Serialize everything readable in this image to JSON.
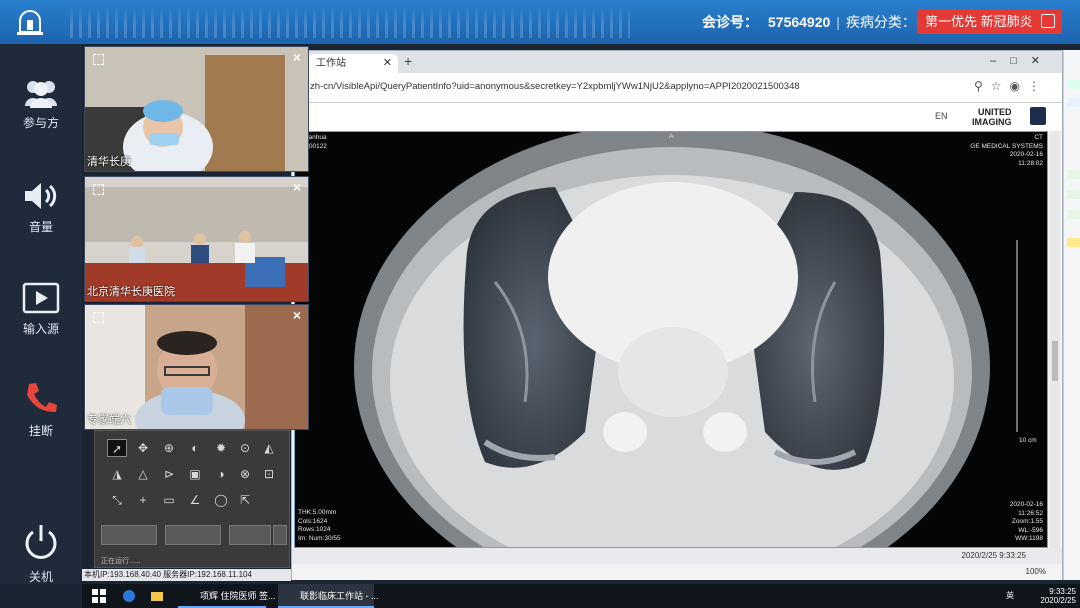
{
  "header": {
    "meeting_label": "会诊号：",
    "meeting_number": "57564920",
    "separator": "|",
    "category_label": "疾病分类：",
    "priority_text": "第一优先 新冠肺炎",
    "logo_icon": "siren-icon",
    "edit_icon": "edit-icon"
  },
  "sidebar": {
    "items": [
      {
        "label": "参与方",
        "icon": "participants-icon"
      },
      {
        "label": "音量",
        "icon": "speaker-icon"
      },
      {
        "label": "输入源",
        "icon": "play-icon"
      },
      {
        "label": "挂断",
        "icon": "hangup-icon"
      },
      {
        "label": "关机",
        "icon": "power-icon"
      }
    ]
  },
  "videos": [
    {
      "caption": "清华长庚"
    },
    {
      "caption": "北京清华长庚医院"
    },
    {
      "caption": "专家端六"
    }
  ],
  "browser": {
    "tab_title": "工作站",
    "url": "zh-cn/VisibleApi/QueryPatientInfo?uid=anonymous&secretkey=Y2xpbmljYWw1NjU2&applyno=APPI2020021500348",
    "lang": "EN",
    "brand_line1": "UNITED",
    "brand_line2": "IMAGING",
    "viewer": {
      "top_left": [
        "ngyanhua",
        "20200122"
      ],
      "top_center": "A",
      "top_right": [
        "CT",
        "GE MEDICAL SYSTEMS",
        "2020-02-16",
        "11:28:02"
      ],
      "bottom_left": [
        "THK:5.00mm",
        "Cols:1624",
        "Rows:1024",
        "Im: Num:30/55"
      ],
      "bottom_right": [
        "2020-02-16",
        "11:26:52",
        "Zoom:1.55",
        "WL:-596",
        "WW:1198"
      ],
      "scale": "10 cm"
    },
    "status_date": "2020/2/25   9:33:25",
    "zoom": "100%"
  },
  "tools": {
    "running_text": "正在运行......",
    "icons": [
      "pointer-icon",
      "pan-icon",
      "zoom-icon",
      "contrast-icon",
      "brightness-icon",
      "magnify-icon",
      "flip-icon",
      "flip-h-icon",
      "triangle-icon",
      "rotate-icon",
      "video-icon",
      "invert-icon",
      "search-icon",
      "fit-icon",
      "measure-icon",
      "cross-icon",
      "ruler-icon",
      "angle-icon",
      "ellipse-icon",
      "export-icon"
    ]
  },
  "status": {
    "ip_text": "本机IP:193.168.40.40 服务器IP:192.168.11.104"
  },
  "taskbar": {
    "apps": [
      "项辉 住院医师 签...",
      "联影临床工作站 - ..."
    ],
    "time": "9:33:25",
    "date": "2020/2/25",
    "ime": "英"
  },
  "colors": {
    "topbar": "#1d63ad",
    "priority": "#e53935",
    "sidebar": "#1f2a3b",
    "hangup": "#e8453c"
  }
}
